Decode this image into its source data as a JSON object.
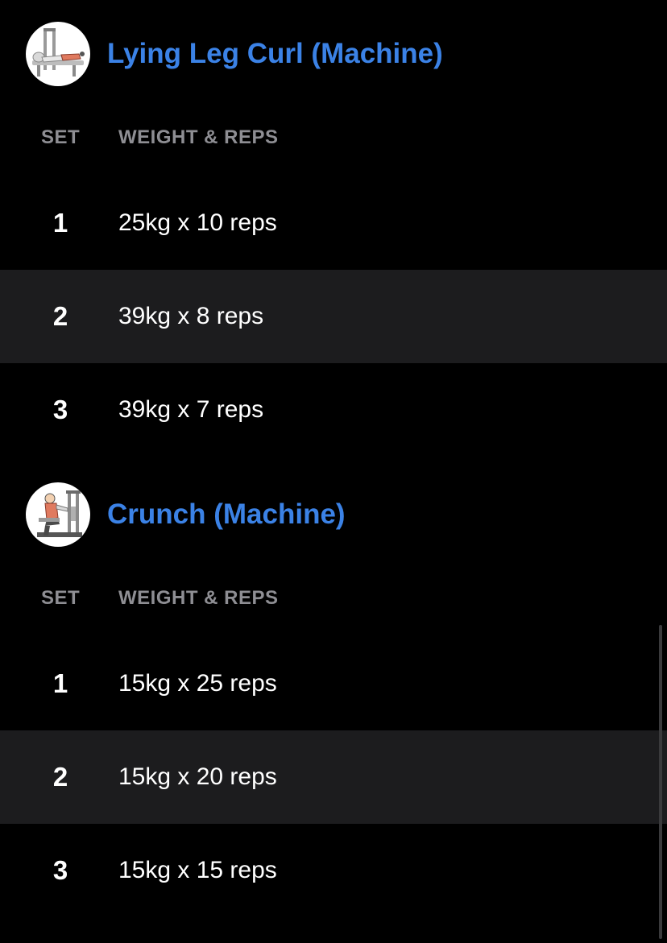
{
  "columns": {
    "set": "SET",
    "weight_reps": "WEIGHT & REPS"
  },
  "exercises": [
    {
      "title": "Lying Leg Curl (Machine)",
      "thumbnail_icon": "leg-curl-machine-icon",
      "sets": [
        {
          "set": "1",
          "value": "25kg x 10 reps"
        },
        {
          "set": "2",
          "value": "39kg x 8 reps"
        },
        {
          "set": "3",
          "value": "39kg x 7 reps"
        }
      ]
    },
    {
      "title": "Crunch (Machine)",
      "thumbnail_icon": "crunch-machine-icon",
      "sets": [
        {
          "set": "1",
          "value": "15kg x 25 reps"
        },
        {
          "set": "2",
          "value": "15kg x 20 reps"
        },
        {
          "set": "3",
          "value": "15kg x 15 reps"
        }
      ]
    }
  ],
  "colors": {
    "background": "#000000",
    "alt_row": "#1c1c1e",
    "title_accent": "#3b82e6",
    "header_text": "#8e8e93",
    "primary_text": "#ffffff"
  }
}
